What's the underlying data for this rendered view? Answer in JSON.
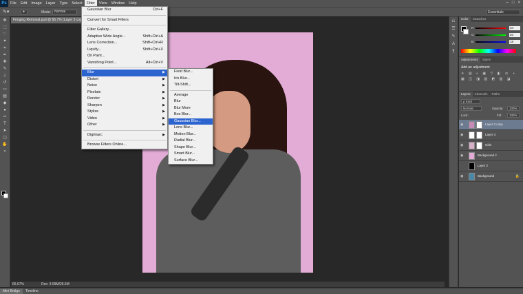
{
  "app": {
    "logo": "Ps"
  },
  "menubar": [
    "File",
    "Edit",
    "Image",
    "Layer",
    "Type",
    "Select",
    "Filter",
    "View",
    "Window",
    "Help"
  ],
  "window_controls": [
    "–",
    "□",
    "×"
  ],
  "options": {
    "mode_label": "Mode:",
    "mode_value": "Normal",
    "workspace": "Essentials"
  },
  "document": {
    "tab_title": "Fringing Removal.psd @ 66.7% (Layer 3 copy, RGB/8) *"
  },
  "status": {
    "zoom": "66.67%",
    "doc": "Doc: 3.59M/25.6M"
  },
  "bottom_tabs": [
    "Mini Bridge",
    "Timeline"
  ],
  "filter_menu": {
    "items": [
      {
        "label": "Gaussian Blur",
        "shortcut": "Ctrl+F"
      },
      {
        "sep": true
      },
      {
        "label": "Convert for Smart Filters"
      },
      {
        "sep": true
      },
      {
        "label": "Filter Gallery..."
      },
      {
        "label": "Adaptive Wide Angle...",
        "shortcut": "Shift+Ctrl+A"
      },
      {
        "label": "Lens Correction...",
        "shortcut": "Shift+Ctrl+R"
      },
      {
        "label": "Liquify...",
        "shortcut": "Shift+Ctrl+X"
      },
      {
        "label": "Oil Paint..."
      },
      {
        "label": "Vanishing Point...",
        "shortcut": "Alt+Ctrl+V"
      },
      {
        "sep": true
      },
      {
        "label": "Blur",
        "submenu": true,
        "highlighted": true
      },
      {
        "label": "Distort",
        "submenu": true
      },
      {
        "label": "Noise",
        "submenu": true
      },
      {
        "label": "Pixelate",
        "submenu": true
      },
      {
        "label": "Render",
        "submenu": true
      },
      {
        "label": "Sharpen",
        "submenu": true
      },
      {
        "label": "Stylize",
        "submenu": true
      },
      {
        "label": "Video",
        "submenu": true
      },
      {
        "label": "Other",
        "submenu": true
      },
      {
        "sep": true
      },
      {
        "label": "Digimarc",
        "submenu": true
      },
      {
        "sep": true
      },
      {
        "label": "Browse Filters Online..."
      }
    ]
  },
  "blur_submenu": {
    "items": [
      {
        "label": "Field Blur..."
      },
      {
        "label": "Iris Blur..."
      },
      {
        "label": "Tilt-Shift..."
      },
      {
        "sep": true
      },
      {
        "label": "Average"
      },
      {
        "label": "Blur"
      },
      {
        "label": "Blur More"
      },
      {
        "label": "Box Blur..."
      },
      {
        "label": "Gaussian Blur...",
        "highlighted": true
      },
      {
        "label": "Lens Blur..."
      },
      {
        "label": "Motion Blur..."
      },
      {
        "label": "Radial Blur..."
      },
      {
        "label": "Shape Blur..."
      },
      {
        "label": "Smart Blur..."
      },
      {
        "label": "Surface Blur..."
      }
    ]
  },
  "color_panel": {
    "tabs": [
      "Color",
      "Swatches"
    ],
    "sliders": [
      {
        "label": "R",
        "value": "34",
        "color": "#e04040"
      },
      {
        "label": "G",
        "value": "20",
        "color": "#40c040"
      },
      {
        "label": "B",
        "value": "18",
        "color": "#4060e0"
      }
    ]
  },
  "adjustments_panel": {
    "tabs": [
      "Adjustments",
      "Styles"
    ],
    "title": "Add an adjustment",
    "icons": "☀ ▤ ◐ ▣ ▽ ◧ ⚖ ◑ ▦ ◫ ◨ ▧ ◩ ▨ ◪"
  },
  "layers_panel": {
    "tabs": [
      "Layers",
      "Channels",
      "Paths"
    ],
    "kind": "ρ Kind",
    "blend": "Normal",
    "opacity_label": "Opacity:",
    "opacity": "100%",
    "lock_label": "Lock:",
    "fill_label": "Fill:",
    "fill": "100%",
    "layers": [
      {
        "name": "Layer 3 copy",
        "selected": true,
        "thumb": "#c58ab5",
        "mask": true,
        "visible": true
      },
      {
        "name": "Layer 3",
        "selected": false,
        "thumb": "#ffffff",
        "mask": true,
        "visible": true
      },
      {
        "name": "Girls",
        "selected": false,
        "thumb": "#d8b0c8",
        "mask": true,
        "visible": true
      },
      {
        "name": "Background 2",
        "selected": false,
        "thumb": "#e2acd6",
        "mask": false,
        "visible": true
      },
      {
        "name": "Layer 2",
        "selected": false,
        "thumb": "#000000",
        "mask": false,
        "visible": false
      },
      {
        "name": "Background",
        "selected": false,
        "thumb": "#4a88a8",
        "mask": false,
        "visible": true,
        "locked": true
      }
    ]
  }
}
